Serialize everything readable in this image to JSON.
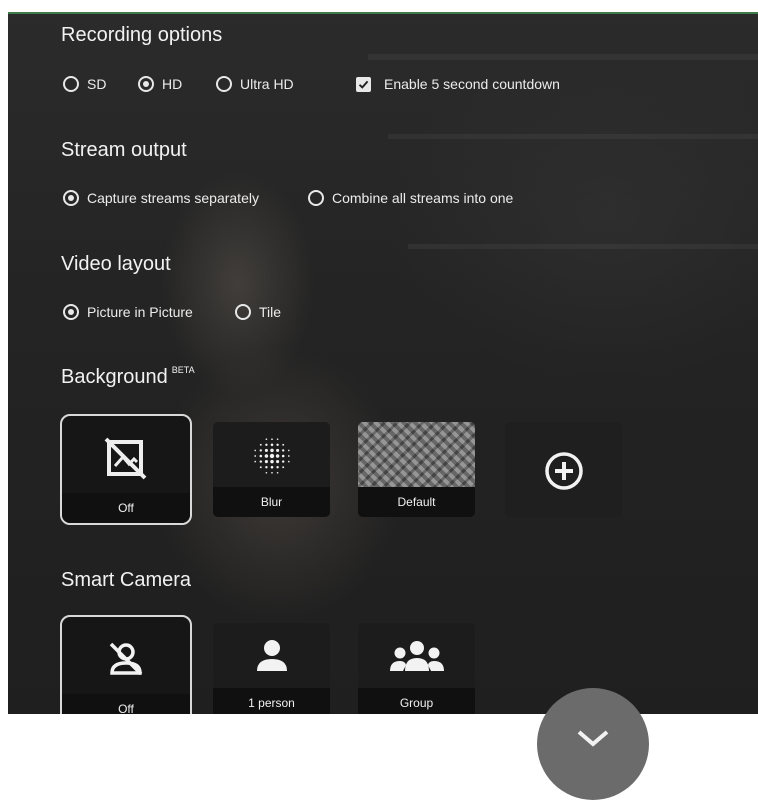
{
  "recording": {
    "heading": "Recording options",
    "quality_options": [
      {
        "label": "SD",
        "selected": false
      },
      {
        "label": "HD",
        "selected": true
      },
      {
        "label": "Ultra HD",
        "selected": false
      }
    ],
    "countdown_label": "Enable 5 second countdown",
    "countdown_checked": true
  },
  "stream": {
    "heading": "Stream output",
    "options": [
      {
        "label": "Capture streams separately",
        "selected": true
      },
      {
        "label": "Combine all streams into one",
        "selected": false
      }
    ]
  },
  "layout": {
    "heading": "Video layout",
    "options": [
      {
        "label": "Picture in Picture",
        "selected": true
      },
      {
        "label": "Tile",
        "selected": false
      }
    ]
  },
  "background": {
    "heading": "Background",
    "badge": "BETA",
    "tiles": [
      {
        "label": "Off",
        "icon": "no-image-icon",
        "selected": true
      },
      {
        "label": "Blur",
        "icon": "blur-dots-icon",
        "selected": false
      },
      {
        "label": "Default",
        "icon": "default-pattern-thumbnail",
        "selected": false
      },
      {
        "label": "",
        "icon": "add-circle-icon",
        "selected": false
      }
    ]
  },
  "smart_camera": {
    "heading": "Smart Camera",
    "tiles": [
      {
        "label": "Off",
        "icon": "person-off-icon",
        "selected": true
      },
      {
        "label": "1 person",
        "icon": "person-icon",
        "selected": false
      },
      {
        "label": "Group",
        "icon": "group-icon",
        "selected": false
      }
    ]
  },
  "scroll_button_icon": "chevron-down-icon",
  "colors": {
    "selected_border": "#d9d9d9",
    "panel_bg": "#242424",
    "top_accent": "#3f7a4a"
  }
}
